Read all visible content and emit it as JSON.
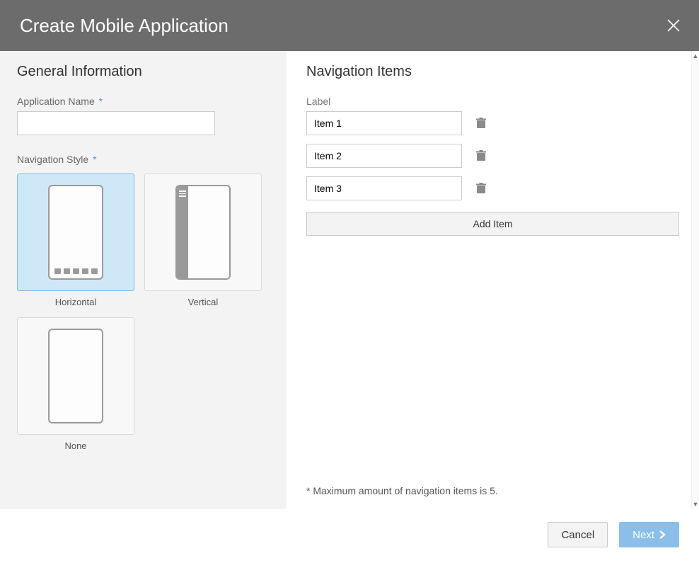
{
  "dialog": {
    "title": "Create Mobile Application"
  },
  "left": {
    "heading": "General Information",
    "appNameLabel": "Application Name",
    "appNameRequired": "*",
    "appNameValue": "",
    "navStyleLabel": "Navigation Style",
    "navStyleRequired": "*",
    "styles": {
      "horizontal": "Horizontal",
      "vertical": "Vertical",
      "none": "None"
    },
    "selectedStyle": "horizontal"
  },
  "right": {
    "heading": "Navigation Items",
    "columnLabel": "Label",
    "items": [
      {
        "value": "Item 1"
      },
      {
        "value": "Item 2"
      },
      {
        "value": "Item 3"
      }
    ],
    "addItemLabel": "Add Item",
    "note": "* Maximum amount of navigation items is 5."
  },
  "footer": {
    "cancel": "Cancel",
    "next": "Next"
  }
}
